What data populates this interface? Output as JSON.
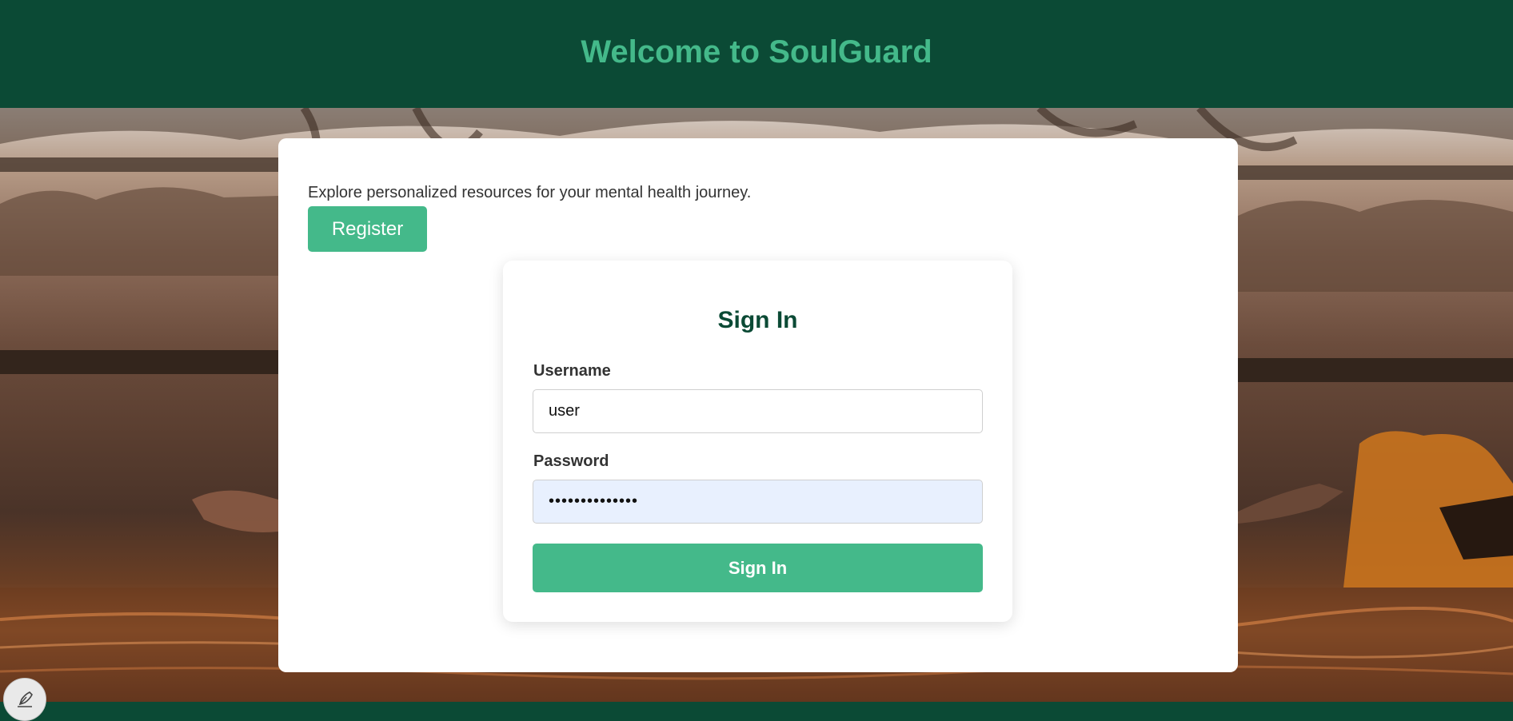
{
  "header": {
    "title": "Welcome to SoulGuard"
  },
  "main": {
    "intro_text": "Explore personalized resources for your mental health journey.",
    "register_label": "Register"
  },
  "signin": {
    "title": "Sign In",
    "username_label": "Username",
    "username_value": "user",
    "password_label": "Password",
    "password_value": "••••••••••••••",
    "submit_label": "Sign In"
  },
  "floating": {
    "edit_icon": "feather-pen-icon"
  },
  "colors": {
    "header_bg": "#0b4a35",
    "header_title": "#44b98a",
    "accent": "#44b98a",
    "signin_title": "#0b4a35",
    "password_autofill_bg": "#e8f0fe"
  }
}
